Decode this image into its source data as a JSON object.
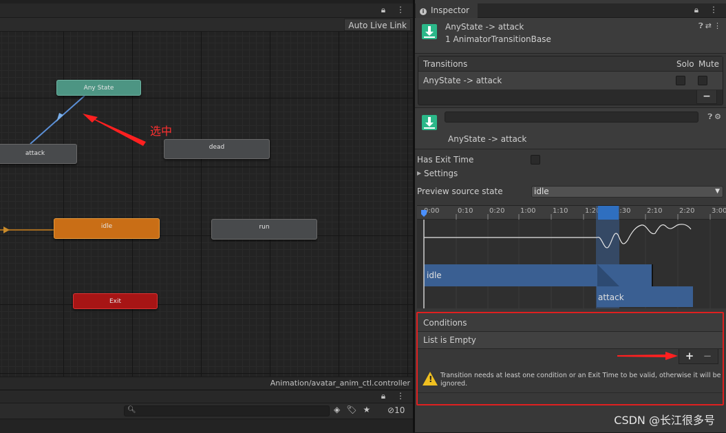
{
  "animator": {
    "toolbar": {
      "auto_live_link": "Auto Live Link"
    },
    "nodes": {
      "any_state": "Any State",
      "attack": "attack",
      "dead": "dead",
      "idle": "idle",
      "run": "run",
      "exit": "Exit"
    },
    "annotation_label": "选中",
    "status_path": "Animation/avatar_anim_ctl.controller"
  },
  "bottom_panel": {
    "search": {
      "value": "",
      "placeholder": ""
    },
    "hidden_count": "10"
  },
  "inspector": {
    "tab_label": "Inspector",
    "header": {
      "title": "AnyState -> attack",
      "subtitle": "1 AnimatorTransitionBase"
    },
    "transitions": {
      "heading": "Transitions",
      "solo_label": "Solo",
      "mute_label": "Mute",
      "rows": [
        {
          "label": "AnyState -> attack",
          "solo": false,
          "mute": false
        }
      ],
      "remove_label": "−"
    },
    "transition": {
      "name_value": "",
      "label": "AnyState -> attack"
    },
    "has_exit_time": {
      "label": "Has Exit Time",
      "checked": false
    },
    "settings_label": "Settings",
    "preview_source_state": {
      "label": "Preview source state",
      "value": "idle"
    },
    "timeline": {
      "ticks": [
        "0:00",
        "0:10",
        "0:20",
        "1:00",
        "1:10",
        "1:20",
        "1:30",
        "2:10",
        "2:20",
        "3:00"
      ],
      "bars": {
        "idle": "idle",
        "attack": "attack"
      }
    },
    "conditions": {
      "heading": "Conditions",
      "empty_text": "List is Empty",
      "add_label": "+",
      "remove_label": "−",
      "warning": "Transition needs at least one condition or an Exit Time to be valid, otherwise it will be ignored."
    }
  },
  "watermark": "CSDN @长江很多号",
  "colors": {
    "any_state": "#4d9583",
    "idle_default": "#c96e16",
    "exit": "#a71515",
    "transition_line": "#5b8fd6",
    "annotation_red": "#e02020",
    "timeline_blue": "#3a5f92"
  }
}
